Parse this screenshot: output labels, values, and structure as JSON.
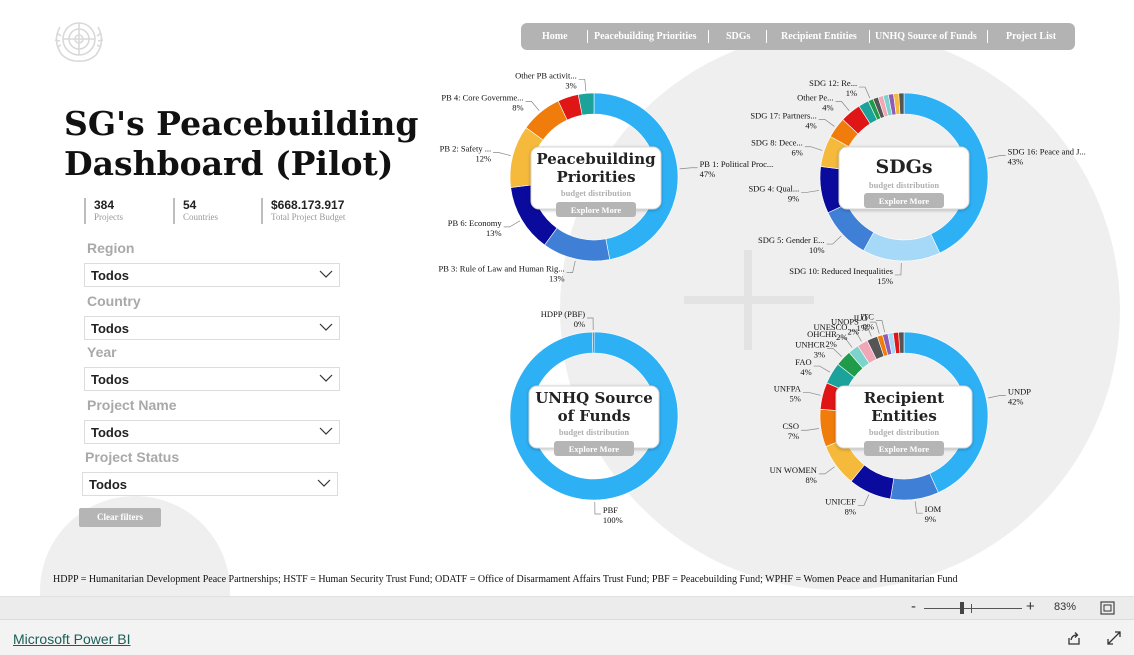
{
  "header": {
    "title_line1": "SG's Peacebuilding",
    "title_line2": "Dashboard (Pilot)"
  },
  "nav": {
    "items": [
      "Home",
      "Peacebuilding Priorities",
      "SDGs",
      "Recipient Entities",
      "UNHQ Source of Funds",
      "Project List"
    ]
  },
  "kpis": [
    {
      "value": "384",
      "label": "Projects"
    },
    {
      "value": "54",
      "label": "Countries"
    },
    {
      "value": "$668.173.917",
      "label": "Total Project Budget"
    }
  ],
  "filters": [
    {
      "label": "Region",
      "value": "Todos"
    },
    {
      "label": "Country",
      "value": "Todos"
    },
    {
      "label": "Year",
      "value": "Todos"
    },
    {
      "label": "Project Name",
      "value": "Todos"
    },
    {
      "label": "Project Status",
      "value": "Todos"
    }
  ],
  "clear_filters_label": "Clear filters",
  "colors": {
    "blue": "#2eb0f5",
    "mid_blue": "#3f7fd6",
    "navy": "#0a0a9c",
    "yellow": "#f5b93b",
    "orange": "#f07c0c",
    "red": "#e01515",
    "teal": "#1ba29b",
    "green": "#1f9b4a",
    "dark_grey": "#555555",
    "pink": "#f0a8b8",
    "light_teal": "#7cd3cc",
    "purple": "#8e5bb5",
    "light_blue": "#a6d8f7"
  },
  "chart_data": [
    {
      "type": "pie",
      "title_line1": "Peacebuilding",
      "title_line2": "Priorities",
      "subtitle": "budget distribution",
      "button": "Explore More",
      "slices": [
        {
          "label": "PB 1: Political Proc...",
          "pct_label": "47%",
          "value": 47,
          "color": "blue"
        },
        {
          "label": "PB 3: Rule of Law and Human Rig...",
          "pct_label": "13%",
          "value": 13,
          "color": "mid_blue"
        },
        {
          "label": "PB 6: Economy",
          "pct_label": "13%",
          "value": 13,
          "color": "navy"
        },
        {
          "label": "PB 2: Safety ...",
          "pct_label": "12%",
          "value": 12,
          "color": "yellow"
        },
        {
          "label": "PB 4: Core Governme...",
          "pct_label": "8%",
          "value": 8,
          "color": "orange"
        },
        {
          "label": "",
          "pct_label": "",
          "value": 4,
          "color": "red"
        },
        {
          "label": "Other PB activit...",
          "pct_label": "3%",
          "value": 3,
          "color": "teal"
        }
      ]
    },
    {
      "type": "pie",
      "title_line1": "SDGs",
      "title_line2": "",
      "subtitle": "budget distribution",
      "button": "Explore More",
      "slices": [
        {
          "label": "SDG 16: Peace and J...",
          "pct_label": "43%",
          "value": 43,
          "color": "blue"
        },
        {
          "label": "SDG 10: Reduced Inequalities",
          "pct_label": "15%",
          "value": 15,
          "color": "light_blue"
        },
        {
          "label": "SDG 5: Gender E...",
          "pct_label": "10%",
          "value": 10,
          "color": "mid_blue"
        },
        {
          "label": "SDG 4: Qual...",
          "pct_label": "9%",
          "value": 9,
          "color": "navy"
        },
        {
          "label": "SDG 8: Dece...",
          "pct_label": "6%",
          "value": 6,
          "color": "yellow"
        },
        {
          "label": "SDG 17: Partners...",
          "pct_label": "4%",
          "value": 4,
          "color": "orange"
        },
        {
          "label": "Other Pe...",
          "pct_label": "4%",
          "value": 4,
          "color": "red"
        },
        {
          "label": "",
          "pct_label": "",
          "value": 2,
          "color": "teal"
        },
        {
          "label": "SDG 12: Re...",
          "pct_label": "1%",
          "value": 1,
          "color": "green"
        },
        {
          "label": "",
          "pct_label": "",
          "value": 1,
          "color": "dark_grey"
        },
        {
          "label": "",
          "pct_label": "",
          "value": 1,
          "color": "pink"
        },
        {
          "label": "",
          "pct_label": "",
          "value": 1,
          "color": "light_teal"
        },
        {
          "label": "",
          "pct_label": "",
          "value": 1,
          "color": "purple"
        },
        {
          "label": "",
          "pct_label": "",
          "value": 1,
          "color": "yellow"
        },
        {
          "label": "",
          "pct_label": "",
          "value": 1,
          "color": "dark_grey"
        }
      ]
    },
    {
      "type": "pie",
      "title_line1": "UNHQ Source",
      "title_line2": "of Funds",
      "subtitle": "budget distribution",
      "button": "Explore More",
      "slices": [
        {
          "label": "PBF",
          "pct_label": "100%",
          "value": 100,
          "color": "blue"
        },
        {
          "label": "HDPP (PBF)",
          "pct_label": "0%",
          "value": 0.3,
          "color": "dark_grey"
        }
      ]
    },
    {
      "type": "pie",
      "title_line1": "Recipient",
      "title_line2": "Entities",
      "subtitle": "budget distribution",
      "button": "Explore More",
      "slices": [
        {
          "label": "UNDP",
          "pct_label": "42%",
          "value": 42,
          "color": "blue"
        },
        {
          "label": "IOM",
          "pct_label": "9%",
          "value": 9,
          "color": "mid_blue"
        },
        {
          "label": "UNICEF",
          "pct_label": "8%",
          "value": 8,
          "color": "navy"
        },
        {
          "label": "UN WOMEN",
          "pct_label": "8%",
          "value": 8,
          "color": "yellow"
        },
        {
          "label": "CSO",
          "pct_label": "7%",
          "value": 7,
          "color": "orange"
        },
        {
          "label": "UNFPA",
          "pct_label": "5%",
          "value": 5,
          "color": "red"
        },
        {
          "label": "FAO",
          "pct_label": "4%",
          "value": 4,
          "color": "teal"
        },
        {
          "label": "UNHCR",
          "pct_label": "3%",
          "value": 3,
          "color": "green"
        },
        {
          "label": "OHCHR",
          "pct_label": "2%",
          "value": 2,
          "color": "light_teal"
        },
        {
          "label": "UNESCO",
          "pct_label": "2%",
          "value": 2,
          "color": "pink"
        },
        {
          "label": "UNOPS",
          "pct_label": "2%",
          "value": 2,
          "color": "dark_grey"
        },
        {
          "label": "ILO",
          "pct_label": "1%",
          "value": 1,
          "color": "orange"
        },
        {
          "label": "ITC",
          "pct_label": "0%",
          "value": 1,
          "color": "purple"
        },
        {
          "label": "",
          "pct_label": "",
          "value": 1,
          "color": "light_blue"
        },
        {
          "label": "",
          "pct_label": "",
          "value": 1,
          "color": "red"
        },
        {
          "label": "",
          "pct_label": "",
          "value": 1,
          "color": "dark_grey"
        }
      ]
    }
  ],
  "footnote": "HDPP = Humanitarian Development Peace Partnerships; HSTF = Human Security Trust Fund; ODATF = Office of Disarmament Affairs Trust Fund; PBF = Peacebuilding Fund; WPHF = Women Peace and Humanitarian Fund",
  "zoom": {
    "minus": "-",
    "plus": "+",
    "percent": "83%",
    "value": 83
  },
  "footer": {
    "link": "Microsoft Power BI"
  }
}
